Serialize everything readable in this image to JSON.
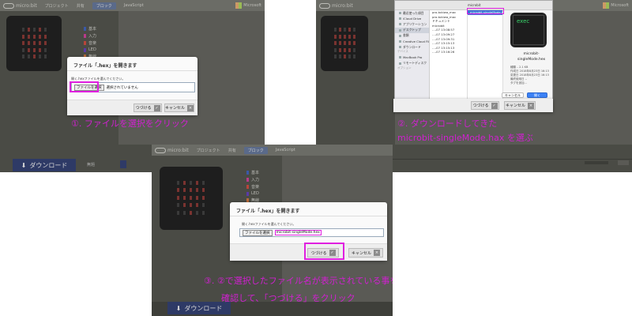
{
  "editor": {
    "logo_text": "micro:bit",
    "projects": "プロジェクト",
    "share": "共有",
    "blocks_tab": "ブロック",
    "js_tab": "JavaScript",
    "microsoft": "Microsoft",
    "categories": [
      {
        "label": "基本",
        "color": "#3a59a8"
      },
      {
        "label": "入力",
        "color": "#b83a8a"
      },
      {
        "label": "音楽",
        "color": "#b8453a"
      },
      {
        "label": "LED",
        "color": "#5a3aa8"
      },
      {
        "label": "無線",
        "color": "#b86a3a"
      }
    ],
    "download_label": "ダウンロード",
    "project_name": "無題"
  },
  "dialog": {
    "title": "ファイル「.hex」を開きます",
    "description": "開く.hexファイルを選んでください。",
    "choose_file": "ファイルを選択",
    "no_file": "選択されていません",
    "selected_file": "microbit-singleMode.hex",
    "continue": "つづける",
    "cancel": "キャンセル"
  },
  "finder": {
    "path": "microbit",
    "sidebar_favorites": [
      "最近使った項目",
      "iCloud Drive",
      "アプリケーション",
      "デスクトップ",
      "書類",
      "Creative Cloud Files",
      "ダウンロード"
    ],
    "sidebar_devices_head": "デバイス",
    "sidebar_devices": [
      "MacBook Pro",
      "リモートディスク"
    ],
    "sidebar_tags_head": "オプション",
    "col1_rows": [
      "pro-tokiwa_mac",
      "pro-tokiwa_mac",
      "ドキュメント",
      "microbit"
    ],
    "col2_rows": [
      "microbit-singleMode.hex"
    ],
    "dates": [
      "…-07 13:08:57",
      "…-07 13:09:27",
      "…-07 13:09:31",
      "…-07 13:15:13",
      "…-07 13:15:13",
      "…-07 13:16:26"
    ],
    "preview_exec": "exec",
    "preview_name": "microbit-\nsingleMode.hex",
    "info_lines": [
      "種類 – 2.1 KB",
      "作成日 2018年8月23日 16:13",
      "変更日 2018年8月23日 16:13",
      "最終使用日 --",
      "タグを追加..."
    ],
    "cancel": "キャンセル",
    "open": "開く"
  },
  "captions": {
    "step1": "①. ファイルを選択をクリック",
    "step2_line1": "②. ダウンロードしてきた",
    "step2_line2": "microbit-singleMode.hax を選ぶ",
    "step3_line1": "③. ②で選択したファイル名が表示されている事を",
    "step3_line2": "確認して、「つづける」をクリック"
  },
  "highlight_color": "#e020e0"
}
